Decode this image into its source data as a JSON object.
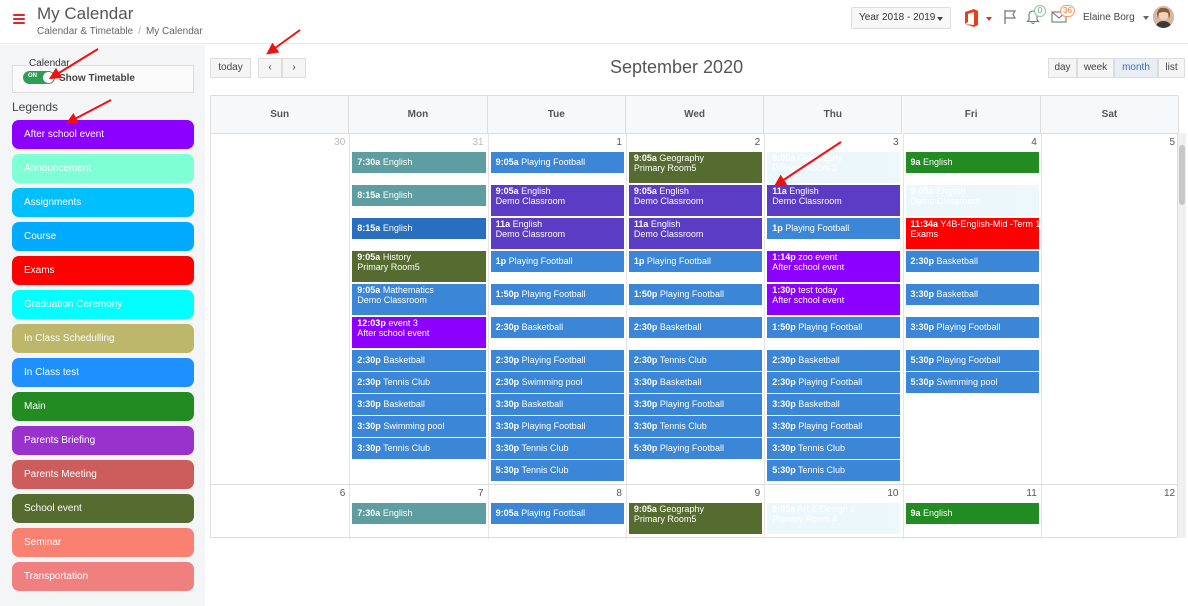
{
  "header": {
    "title": "My Calendar",
    "breadcrumb": [
      "Calendar & Timetable",
      "My Calendar"
    ],
    "breadcrumb_sep": "/",
    "year_select": "Year 2018 - 2019",
    "notif_count": "0",
    "mail_count": "36",
    "user_name": "Elaine Borg"
  },
  "sidebar": {
    "calendar_label": "Calendar",
    "toggle_text": "ON",
    "timetable_label": "Show Timetable",
    "legends_title": "Legends",
    "legends": [
      {
        "label": "After school event",
        "color": "#8b00ff"
      },
      {
        "label": "Announcement",
        "color": "#7fffd4"
      },
      {
        "label": "Assignments",
        "color": "#00bfff"
      },
      {
        "label": "Course",
        "color": "#00aaff"
      },
      {
        "label": "Exams",
        "color": "#ff0000"
      },
      {
        "label": "Graduation Ceremony",
        "color": "#00ffff"
      },
      {
        "label": "In Class Schedulling",
        "color": "#bdb76b"
      },
      {
        "label": "In Class test",
        "color": "#1e90ff"
      },
      {
        "label": "Main",
        "color": "#228b22"
      },
      {
        "label": "Parents Briefing",
        "color": "#9932cc"
      },
      {
        "label": "Parents Meeting",
        "color": "#cd5c5c"
      },
      {
        "label": "School event",
        "color": "#556b2f"
      },
      {
        "label": "Seminar",
        "color": "#fa8072"
      },
      {
        "label": "Transportation",
        "color": "#f08080"
      }
    ]
  },
  "toolbar": {
    "today": "today",
    "prev": "‹",
    "next": "›",
    "title": "September 2020",
    "views": [
      "day",
      "week",
      "month",
      "list"
    ],
    "active_view": "month"
  },
  "calendar": {
    "weekdays": [
      "Sun",
      "Mon",
      "Tue",
      "Wed",
      "Thu",
      "Fri",
      "Sat"
    ],
    "week1_days": [
      "30",
      "31",
      "1",
      "2",
      "3",
      "4",
      "5"
    ],
    "week2_days": [
      "6",
      "7",
      "8",
      "9",
      "10",
      "11",
      "12"
    ],
    "colors": {
      "teal": "#5f9ea0",
      "blue": "#3b86d6",
      "darkblue": "#2a6fbf",
      "indigo": "#5b3cc4",
      "olive": "#556b2f",
      "purple": "#8b00ff",
      "red": "#ff0000",
      "green": "#228b22",
      "lightblue": "#87ceeb"
    },
    "events": [
      {
        "day": 1,
        "slot": 0,
        "time": "7:30a",
        "title": "English",
        "sub": "",
        "color": "teal"
      },
      {
        "day": 1,
        "slot": 1,
        "time": "8:15a",
        "title": "English",
        "sub": "",
        "color": "teal"
      },
      {
        "day": 1,
        "slot": 2,
        "time": "8:15a",
        "title": "English",
        "sub": "",
        "color": "darkblue"
      },
      {
        "day": 1,
        "slot": 3,
        "time": "9:05a",
        "title": "History",
        "sub": "Primary Room5",
        "color": "olive"
      },
      {
        "day": 1,
        "slot": 4,
        "time": "9:05a",
        "title": "Mathematics",
        "sub": "Demo Classroom",
        "color": "blue"
      },
      {
        "day": 1,
        "slot": 5,
        "time": "12:03p",
        "title": "event 3",
        "sub": "After school event",
        "color": "purple"
      },
      {
        "day": 1,
        "slot": 6,
        "time": "2:30p",
        "title": "Basketball",
        "sub": "",
        "color": "blue"
      },
      {
        "day": 1,
        "slot": 7,
        "time": "2:30p",
        "title": "Tennis Club",
        "sub": "",
        "color": "blue"
      },
      {
        "day": 1,
        "slot": 8,
        "time": "3:30p",
        "title": "Basketball",
        "sub": "",
        "color": "blue"
      },
      {
        "day": 1,
        "slot": 9,
        "time": "3:30p",
        "title": "Swimming pool",
        "sub": "",
        "color": "blue"
      },
      {
        "day": 1,
        "slot": 10,
        "time": "3:30p",
        "title": "Tennis Club",
        "sub": "",
        "color": "blue"
      },
      {
        "day": 2,
        "slot": 0,
        "time": "9:05a",
        "title": "Playing Football",
        "sub": "",
        "color": "blue"
      },
      {
        "day": 2,
        "slot": 1,
        "time": "9:05a",
        "title": "English",
        "sub": "Demo Classroom",
        "color": "indigo"
      },
      {
        "day": 2,
        "slot": 2,
        "time": "11a",
        "title": "English",
        "sub": "Demo Classroom",
        "color": "indigo"
      },
      {
        "day": 2,
        "slot": 3,
        "time": "1p",
        "title": "Playing Football",
        "sub": "",
        "color": "blue"
      },
      {
        "day": 2,
        "slot": 4,
        "time": "1:50p",
        "title": "Playing Football",
        "sub": "",
        "color": "blue"
      },
      {
        "day": 2,
        "slot": 5,
        "time": "2:30p",
        "title": "Basketball",
        "sub": "",
        "color": "blue"
      },
      {
        "day": 2,
        "slot": 6,
        "time": "2:30p",
        "title": "Playing Football",
        "sub": "",
        "color": "blue"
      },
      {
        "day": 2,
        "slot": 7,
        "time": "2:30p",
        "title": "Swimming pool",
        "sub": "",
        "color": "blue"
      },
      {
        "day": 2,
        "slot": 8,
        "time": "3:30p",
        "title": "Basketball",
        "sub": "",
        "color": "blue"
      },
      {
        "day": 2,
        "slot": 9,
        "time": "3:30p",
        "title": "Playing Football",
        "sub": "",
        "color": "blue"
      },
      {
        "day": 2,
        "slot": 10,
        "time": "3:30p",
        "title": "Tennis Club",
        "sub": "",
        "color": "blue"
      },
      {
        "day": 2,
        "slot": 11,
        "time": "5:30p",
        "title": "Tennis Club",
        "sub": "",
        "color": "blue"
      },
      {
        "day": 3,
        "slot": 0,
        "time": "9:05a",
        "title": "Geography",
        "sub": "Primary Room5",
        "color": "olive"
      },
      {
        "day": 3,
        "slot": 1,
        "time": "9:05a",
        "title": "English",
        "sub": "Demo Classroom",
        "color": "indigo"
      },
      {
        "day": 3,
        "slot": 2,
        "time": "11a",
        "title": "English",
        "sub": "Demo Classroom",
        "color": "indigo"
      },
      {
        "day": 3,
        "slot": 3,
        "time": "1p",
        "title": "Playing Football",
        "sub": "",
        "color": "blue"
      },
      {
        "day": 3,
        "slot": 4,
        "time": "1:50p",
        "title": "Playing Football",
        "sub": "",
        "color": "blue"
      },
      {
        "day": 3,
        "slot": 5,
        "time": "2:30p",
        "title": "Basketball",
        "sub": "",
        "color": "blue"
      },
      {
        "day": 3,
        "slot": 6,
        "time": "2:30p",
        "title": "Tennis Club",
        "sub": "",
        "color": "blue"
      },
      {
        "day": 3,
        "slot": 7,
        "time": "3:30p",
        "title": "Basketball",
        "sub": "",
        "color": "blue"
      },
      {
        "day": 3,
        "slot": 8,
        "time": "3:30p",
        "title": "Playing Football",
        "sub": "",
        "color": "blue"
      },
      {
        "day": 3,
        "slot": 9,
        "time": "3:30p",
        "title": "Tennis Club",
        "sub": "",
        "color": "blue"
      },
      {
        "day": 3,
        "slot": 10,
        "time": "5:30p",
        "title": "Playing Football",
        "sub": "",
        "color": "blue"
      },
      {
        "day": 4,
        "slot": 0,
        "time": "9:05a",
        "title": "Geography",
        "sub": "Primary Room 2",
        "color": "lightblue",
        "faded": true
      },
      {
        "day": 4,
        "slot": 1,
        "time": "11a",
        "title": "English",
        "sub": "Demo Classroom",
        "color": "indigo"
      },
      {
        "day": 4,
        "slot": 2,
        "time": "1p",
        "title": "Playing Football",
        "sub": "",
        "color": "blue"
      },
      {
        "day": 4,
        "slot": 3,
        "time": "1:14p",
        "title": "zoo event",
        "sub": "After school event",
        "color": "purple"
      },
      {
        "day": 4,
        "slot": 4,
        "time": "1:30p",
        "title": "test today",
        "sub": "After school event",
        "color": "purple"
      },
      {
        "day": 4,
        "slot": 5,
        "time": "1:50p",
        "title": "Playing Football",
        "sub": "",
        "color": "blue"
      },
      {
        "day": 4,
        "slot": 6,
        "time": "2:30p",
        "title": "Basketball",
        "sub": "",
        "color": "blue"
      },
      {
        "day": 4,
        "slot": 7,
        "time": "2:30p",
        "title": "Playing Football",
        "sub": "",
        "color": "blue"
      },
      {
        "day": 4,
        "slot": 8,
        "time": "3:30p",
        "title": "Basketball",
        "sub": "",
        "color": "blue"
      },
      {
        "day": 4,
        "slot": 9,
        "time": "3:30p",
        "title": "Playing Football",
        "sub": "",
        "color": "blue"
      },
      {
        "day": 4,
        "slot": 10,
        "time": "3:30p",
        "title": "Tennis Club",
        "sub": "",
        "color": "blue"
      },
      {
        "day": 4,
        "slot": 11,
        "time": "5:30p",
        "title": "Tennis Club",
        "sub": "",
        "color": "blue"
      },
      {
        "day": 5,
        "slot": 0,
        "time": "9a",
        "title": "English",
        "sub": "",
        "color": "green"
      },
      {
        "day": 5,
        "slot": 1,
        "time": "9:05a",
        "title": "English",
        "sub": "Demo Classroom",
        "color": "lightblue",
        "faded": true
      },
      {
        "day": 5,
        "slot": 2,
        "time": "11:34a",
        "title": "Y4B-English-Mid -Term 1",
        "sub": "Exams",
        "color": "red"
      },
      {
        "day": 5,
        "slot": 3,
        "time": "2:30p",
        "title": "Basketball",
        "sub": "",
        "color": "blue"
      },
      {
        "day": 5,
        "slot": 4,
        "time": "3:30p",
        "title": "Basketball",
        "sub": "",
        "color": "blue"
      },
      {
        "day": 5,
        "slot": 5,
        "time": "3:30p",
        "title": "Playing Football",
        "sub": "",
        "color": "blue"
      },
      {
        "day": 5,
        "slot": 6,
        "time": "5:30p",
        "title": "Playing Football",
        "sub": "",
        "color": "blue"
      },
      {
        "day": 5,
        "slot": 7,
        "time": "5:30p",
        "title": "Swimming pool",
        "sub": "",
        "color": "blue"
      }
    ],
    "week2_events": [
      {
        "day": 1,
        "time": "7:30a",
        "title": "English",
        "sub": "",
        "color": "teal"
      },
      {
        "day": 2,
        "time": "9:05a",
        "title": "Playing Football",
        "sub": "",
        "color": "blue"
      },
      {
        "day": 3,
        "time": "9:05a",
        "title": "Geography",
        "sub": "Primary Room5",
        "color": "olive"
      },
      {
        "day": 4,
        "time": "9:05a",
        "title": "Art & Design 2",
        "sub": "Primary Room 4",
        "color": "lightblue",
        "faded": true
      },
      {
        "day": 5,
        "time": "9a",
        "title": "English",
        "sub": "",
        "color": "green"
      }
    ]
  }
}
